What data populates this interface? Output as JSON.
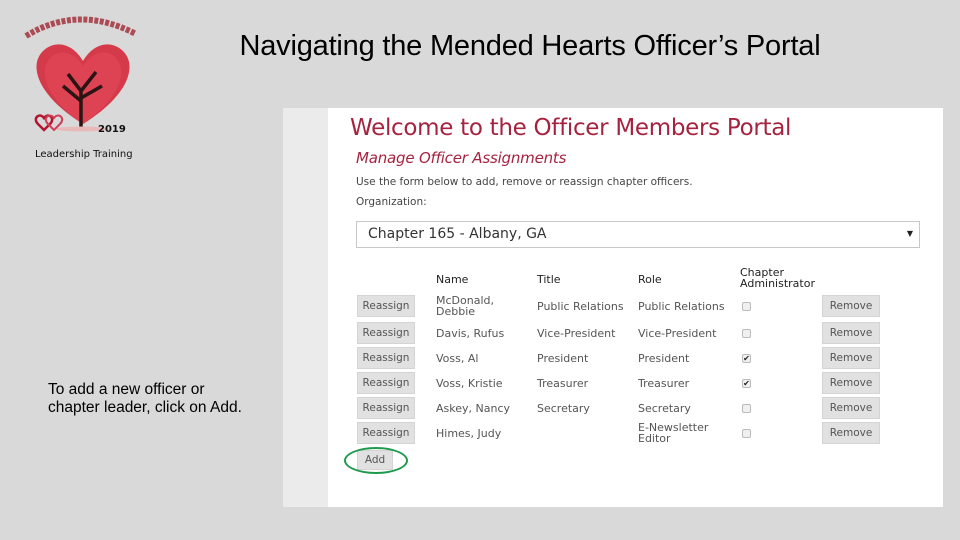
{
  "slide": {
    "title": "Navigating the Mended Hearts Officer’s Portal",
    "caption": "To add a new officer or chapter leader, click on Add.",
    "logo": {
      "year": "2019",
      "caption": "Leadership Training",
      "icon": "heart-tree-logo"
    }
  },
  "portal": {
    "title": "Welcome to the Officer Members Portal",
    "subtitle": "Manage Officer Assignments",
    "description": "Use the form below to add, remove or reassign chapter officers.",
    "organization_label": "Organization:",
    "organization_value": "Chapter 165 - Albany, GA",
    "columns": {
      "name": "Name",
      "title": "Title",
      "role": "Role",
      "admin_line1": "Chapter",
      "admin_line2": "Administrator"
    },
    "reassign_label": "Reassign",
    "remove_label": "Remove",
    "add_label": "Add",
    "accent_color": "#a6233f",
    "highlight_color": "#1e9a4e",
    "officers": [
      {
        "name1": "McDonald,",
        "name2": "Debbie",
        "title": "Public Relations",
        "role1": "Public Relations",
        "role2": "",
        "admin": false
      },
      {
        "name1": "Davis, Rufus",
        "name2": "",
        "title": "Vice-President",
        "role1": "Vice-President",
        "role2": "",
        "admin": false
      },
      {
        "name1": "Voss, Al",
        "name2": "",
        "title": "President",
        "role1": "President",
        "role2": "",
        "admin": true
      },
      {
        "name1": "Voss, Kristie",
        "name2": "",
        "title": "Treasurer",
        "role1": "Treasurer",
        "role2": "",
        "admin": true
      },
      {
        "name1": "Askey, Nancy",
        "name2": "",
        "title": "Secretary",
        "role1": "Secretary",
        "role2": "",
        "admin": false
      },
      {
        "name1": "Himes, Judy",
        "name2": "",
        "title": "",
        "role1": "E-Newsletter",
        "role2": "Editor",
        "admin": false
      }
    ]
  }
}
